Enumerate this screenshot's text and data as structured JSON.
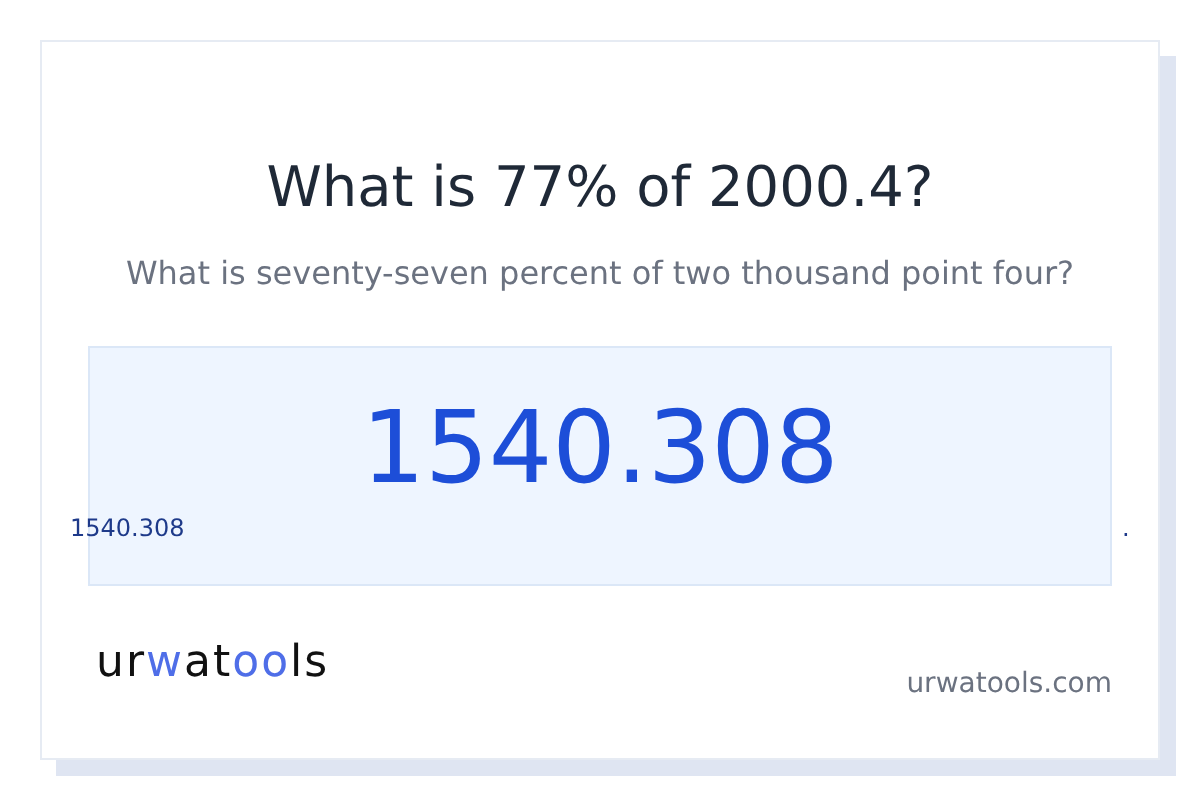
{
  "title": "What is 77% of 2000.4?",
  "subtitle": "What is seventy-seven percent of two thousand point four?",
  "result": {
    "value": "1540.308",
    "caption": "1540.308",
    "trailing": "."
  },
  "logo": {
    "parts": [
      {
        "text": "ur",
        "color": "#111111"
      },
      {
        "text": "w",
        "color": "#4f6ee8"
      },
      {
        "text": "at",
        "color": "#111111"
      },
      {
        "text": "oo",
        "color": "#4f6ee8"
      },
      {
        "text": "ls",
        "color": "#111111"
      }
    ]
  },
  "site": "urwatools.com"
}
